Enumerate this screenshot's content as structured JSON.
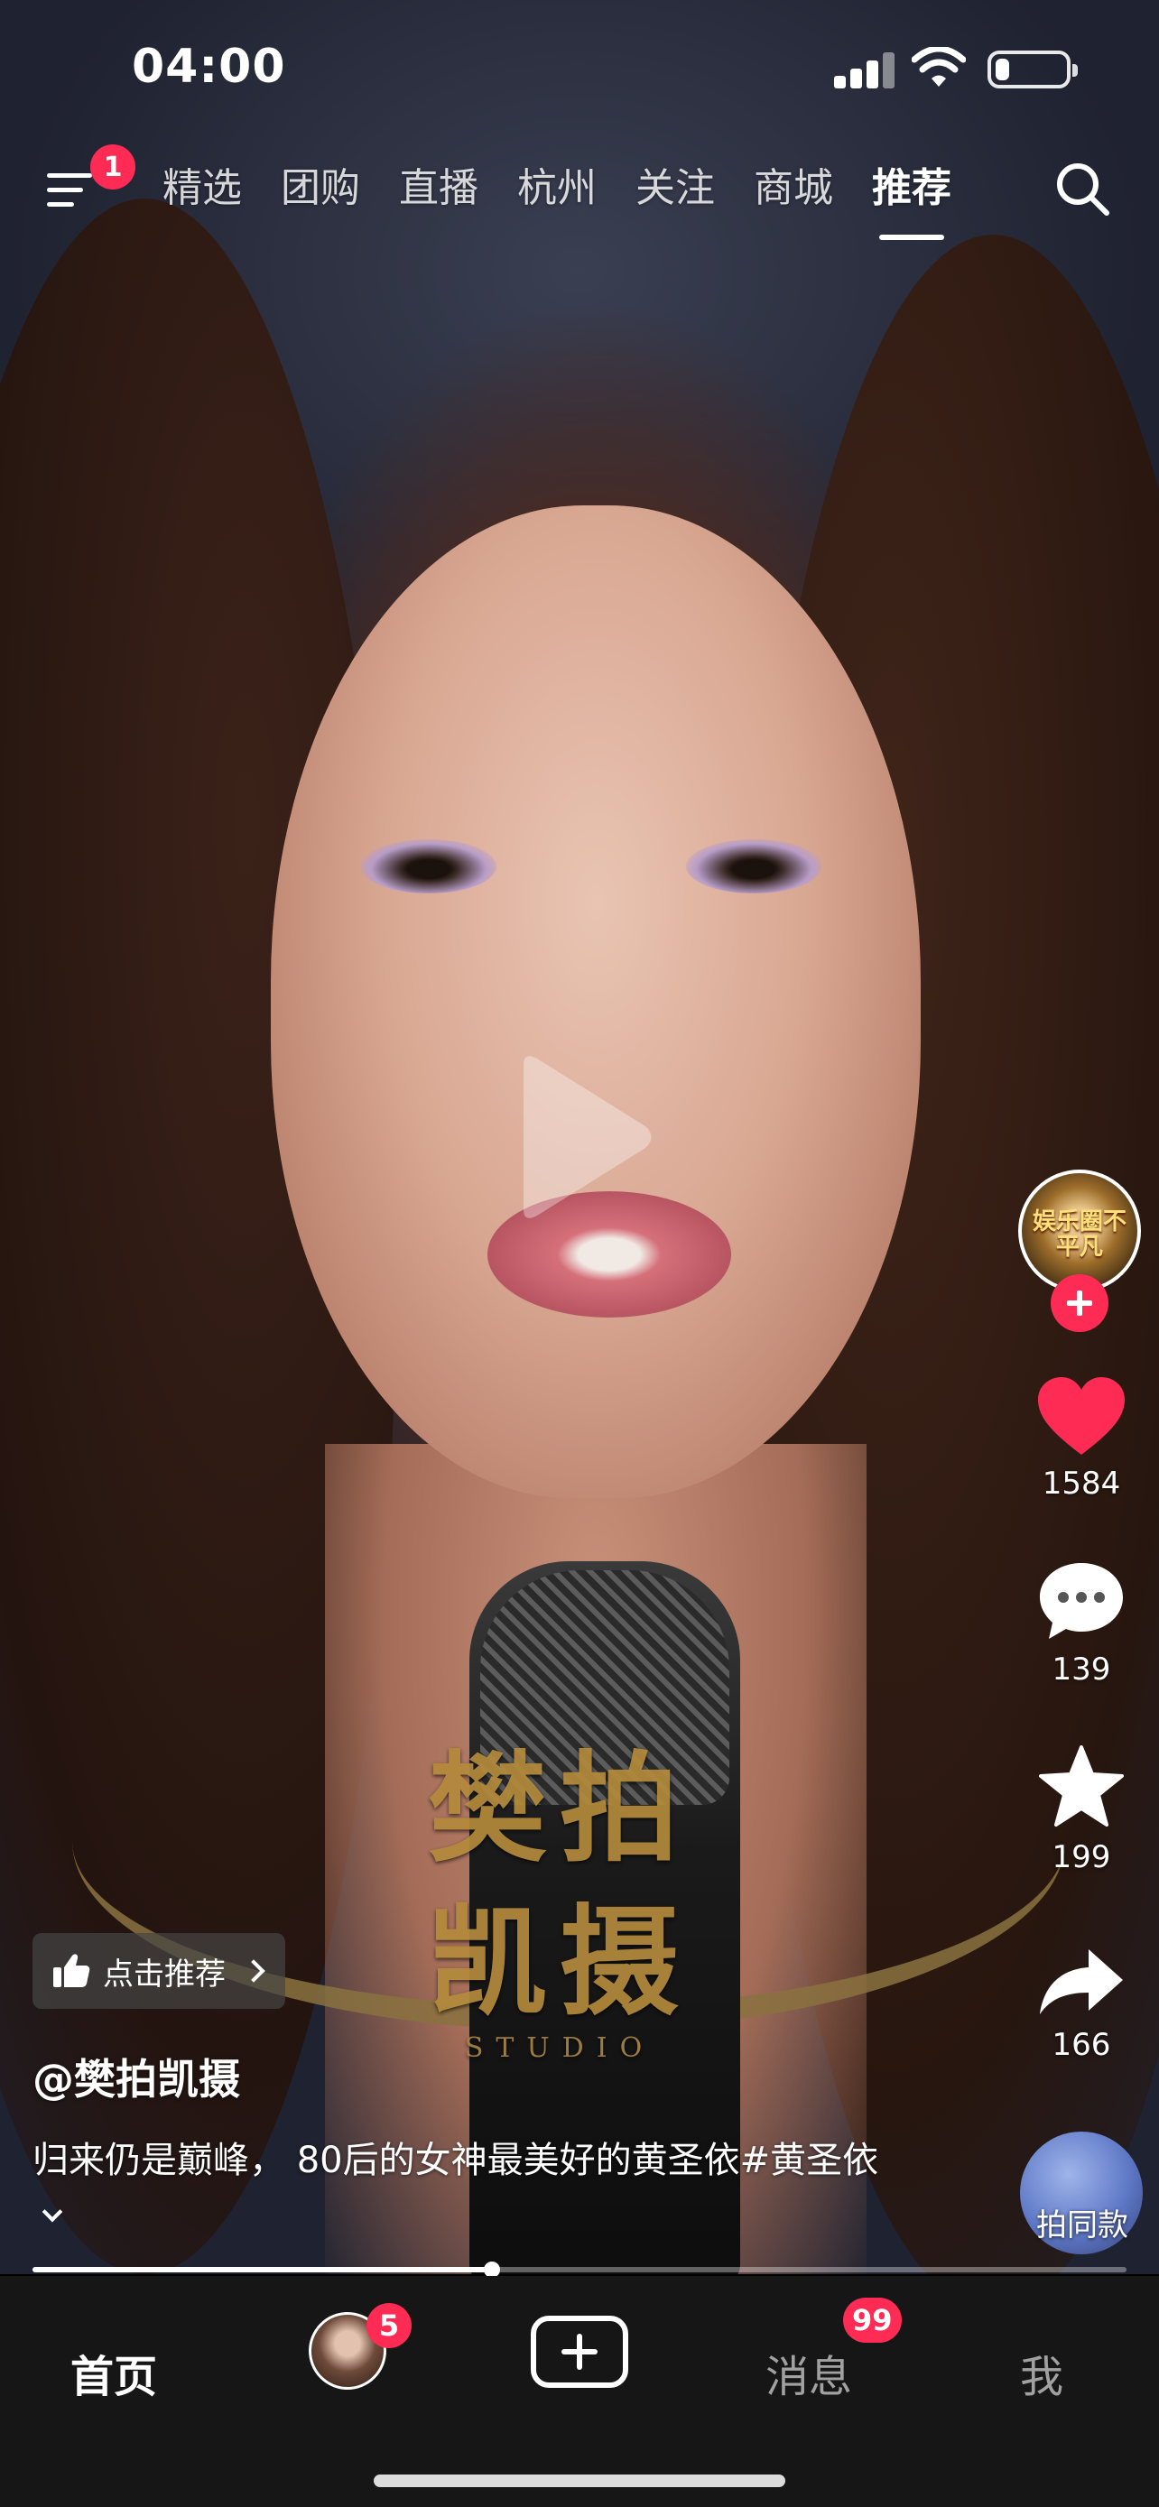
{
  "status_bar": {
    "time": "04:00",
    "battery_fraction": 0.2
  },
  "top_nav": {
    "menu_badge": "1",
    "tabs": [
      "精选",
      "团购",
      "直播",
      "杭州",
      "关注",
      "商城",
      "推荐"
    ],
    "active_tab": "推荐"
  },
  "video": {
    "watermark_line1": "樊拍",
    "watermark_line2": "凯摄",
    "watermark_sub": "STUDIO",
    "progress_fraction": 0.42
  },
  "actions": {
    "author_avatar_text": "娱乐圈不平凡",
    "likes": "1584",
    "comments": "139",
    "favorites": "199",
    "shares": "166",
    "same_style_label": "拍同款"
  },
  "caption": {
    "recommend_chip": "点击推荐",
    "author": "@樊拍凯摄",
    "description": "归来仍是巅峰， 80后的女神最美好的黄圣依#黄圣依"
  },
  "bottom_bar": {
    "home": "首页",
    "friend_badge": "5",
    "messages": "消息",
    "messages_badge": "99",
    "me": "我"
  },
  "colors": {
    "accent": "#fe2c55",
    "tab_bar_bg": "#161616"
  }
}
